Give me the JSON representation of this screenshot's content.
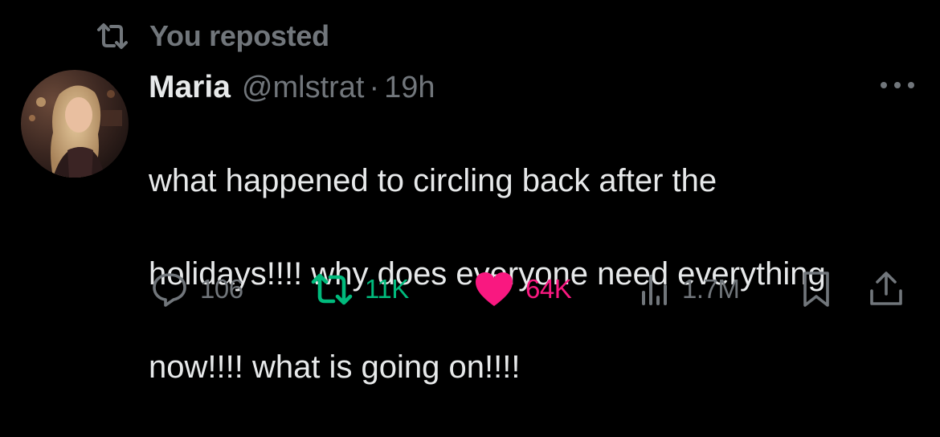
{
  "repost_banner": {
    "icon": "repost-icon",
    "text": "You reposted"
  },
  "author": {
    "avatar": "profile-photo",
    "name": "Maria",
    "handle": "@mlstrat",
    "separator": "·",
    "time": "19h"
  },
  "more_icon": "more-horizontal-icon",
  "tweet": {
    "text_lines": [
      "what happened to circling back after the",
      "holidays!!!! why does everyone need everything",
      "now!!!! what is going on!!!!"
    ]
  },
  "actions": {
    "reply": {
      "icon": "reply-icon",
      "count": "106",
      "color": "#71767b"
    },
    "repost": {
      "icon": "repost-icon",
      "count": "11K",
      "color": "#00ba7c",
      "active": true
    },
    "like": {
      "icon": "heart-icon",
      "count": "64K",
      "color": "#f91880",
      "active": true
    },
    "views": {
      "icon": "views-icon",
      "count": "1.7M",
      "color": "#71767b"
    },
    "bookmark": {
      "icon": "bookmark-icon"
    },
    "share": {
      "icon": "share-icon"
    }
  },
  "colors": {
    "background": "#000000",
    "text_primary": "#e7e9ea",
    "text_secondary": "#71767b"
  }
}
